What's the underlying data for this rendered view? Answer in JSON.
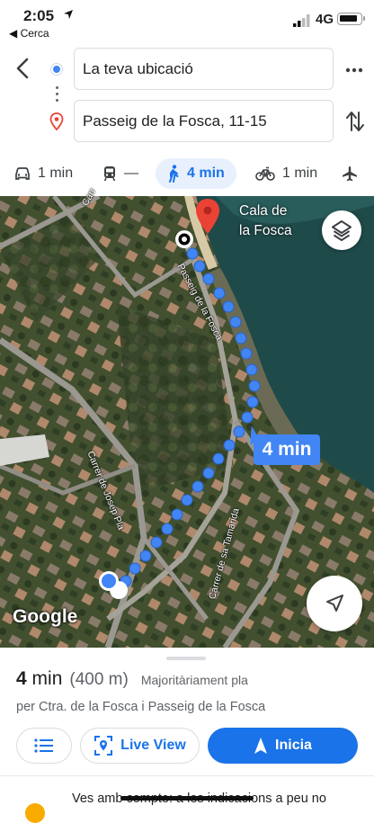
{
  "status_bar": {
    "time": "2:05",
    "back_app": "◀ Cerca",
    "network": "4G"
  },
  "header": {
    "origin_value": "La teva ubicació",
    "destination_value": "Passeig de la Fosca, 11-15"
  },
  "modes": [
    {
      "name": "car",
      "label": "1 min"
    },
    {
      "name": "transit",
      "label": "—"
    },
    {
      "name": "walk",
      "label": "4 min",
      "selected": true
    },
    {
      "name": "bike",
      "label": "1 min"
    },
    {
      "name": "flight",
      "label": ""
    }
  ],
  "map": {
    "place_label_line1": "Cala de",
    "place_label_line2": "la Fosca",
    "route_time": "4 min",
    "streets": [
      "Passeig de la Fosca",
      "Carrer de Josep Pla",
      "Carrer de sa Tamarida",
      "Carr"
    ],
    "logo": "Google"
  },
  "sheet": {
    "duration_value": "4",
    "duration_unit": "min",
    "distance": "(400 m)",
    "terrain": "Majoritàriament pla",
    "via": "per Ctra. de la Fosca i Passeig de la Fosca",
    "liveview_label": "Live View",
    "start_label": "Inicia",
    "warning": "Ves amb compte: a les indicacions a peu no"
  },
  "colors": {
    "accent": "#1a73e8",
    "route": "#4285f4",
    "pin": "#ea4335"
  }
}
